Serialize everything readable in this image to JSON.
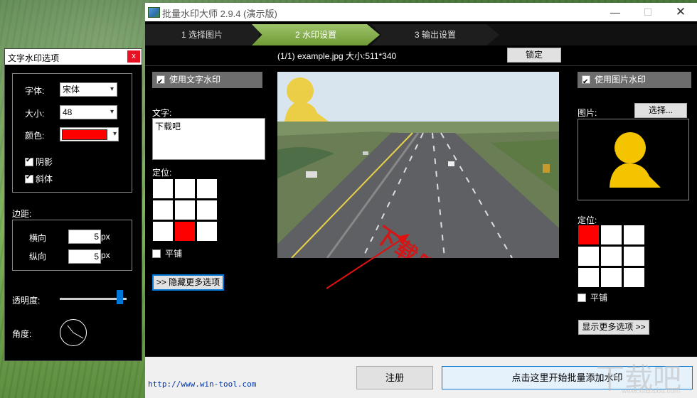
{
  "app": {
    "title": "批量水印大师 2.9.4 (演示版)",
    "minimize": "—",
    "maximize": "☐",
    "close": "✕"
  },
  "steps": [
    {
      "label": "1  选择图片"
    },
    {
      "label": "2  水印设置"
    },
    {
      "label": "3  输出设置"
    }
  ],
  "file_info": "(1/1) example.jpg 大小:511*340",
  "lock_label": "锁定",
  "text_watermark": {
    "checkbox_label": "使用文字水印",
    "checked": true,
    "text_label": "文字:",
    "text_value": "下载吧",
    "position_label": "定位:",
    "tile_label": "平铺",
    "more_options_label": ">> 隐藏更多选项"
  },
  "preview": {
    "watermark_text": "下载吧"
  },
  "image_watermark": {
    "checkbox_label": "使用图片水印",
    "checked": true,
    "image_label": "图片:",
    "choose_label": "选择...",
    "position_label": "定位:",
    "tile_label": "平铺",
    "show_more_label": "显示更多选项 >>"
  },
  "bottom": {
    "url": "http://www.win-tool.com",
    "register_label": "注册",
    "start_label": "点击这里开始批量添加水印"
  },
  "text_panel": {
    "title": "文字水印选项",
    "close": "x",
    "font_label": "字体:",
    "font_value": "宋体",
    "size_label": "大小:",
    "size_value": "48",
    "color_label": "颜色:",
    "color_value": "#ff0000",
    "shadow_label": "阴影",
    "italic_label": "斜体",
    "margin_label": "边距:",
    "horizontal_label": "横向",
    "horizontal_value": "5",
    "vertical_label": "纵向",
    "vertical_value": "5",
    "unit": "px",
    "opacity_label": "透明度:",
    "opacity_level": 0.9,
    "angle_label": "角度:"
  },
  "corner_logo": {
    "text": "下载吧",
    "sub": "www.xiazaiba.com"
  },
  "colors": {
    "accent_step": "#8cb452",
    "selected_cell": "#ff0000",
    "watermark_text": "#d01818",
    "silhouette": "#f5c400"
  }
}
